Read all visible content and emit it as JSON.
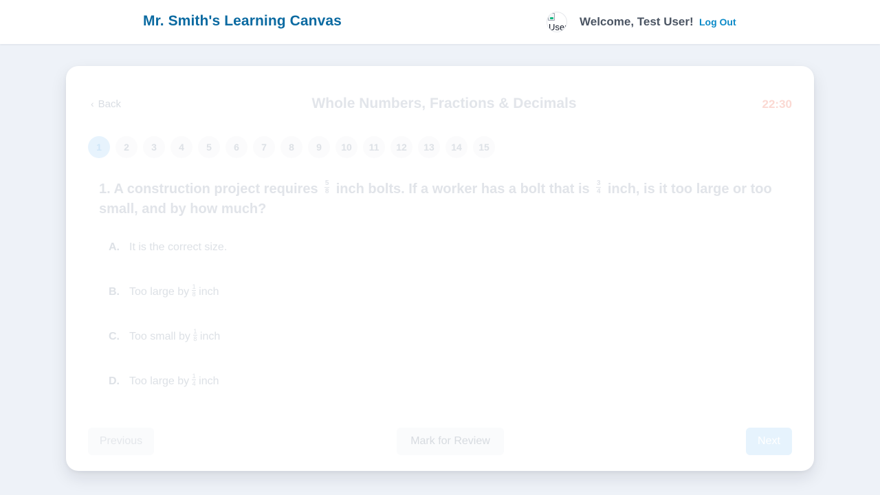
{
  "header": {
    "brand": "Mr. Smith's Learning Canvas",
    "avatar_alt": "User",
    "welcome": "Welcome, Test User!",
    "logout_label": "Log Out"
  },
  "quiz": {
    "back_label": "Back",
    "title": "Whole Numbers, Fractions & Decimals",
    "timer": "22:30",
    "question_numbers": [
      "1",
      "2",
      "3",
      "4",
      "5",
      "6",
      "7",
      "8",
      "9",
      "10",
      "11",
      "12",
      "13",
      "14",
      "15"
    ],
    "current_question": "1",
    "question": {
      "prefix": "1. A construction project requires",
      "frac1": {
        "num": "5",
        "den": "8"
      },
      "middle": "inch bolts. If a worker has a bolt that is",
      "frac2": {
        "num": "3",
        "den": "4"
      },
      "suffix": "inch, is it too large or too small, and by how much?"
    },
    "options": [
      {
        "letter": "A.",
        "text": "It is the correct size."
      },
      {
        "letter": "B.",
        "pre": "Too large by",
        "num": "1",
        "den": "8",
        "post": "inch"
      },
      {
        "letter": "C.",
        "pre": "Too small by",
        "num": "1",
        "den": "8",
        "post": "inch"
      },
      {
        "letter": "D.",
        "pre": "Too large by",
        "num": "1",
        "den": "4",
        "post": "inch"
      }
    ],
    "previous_label": "Previous",
    "review_label": "Mark for Review",
    "next_label": "Next"
  },
  "colors": {
    "brand": "#0b6aa1",
    "link": "#0b8ac8",
    "background": "#eef2f8",
    "timer": "#fbd9d3"
  }
}
